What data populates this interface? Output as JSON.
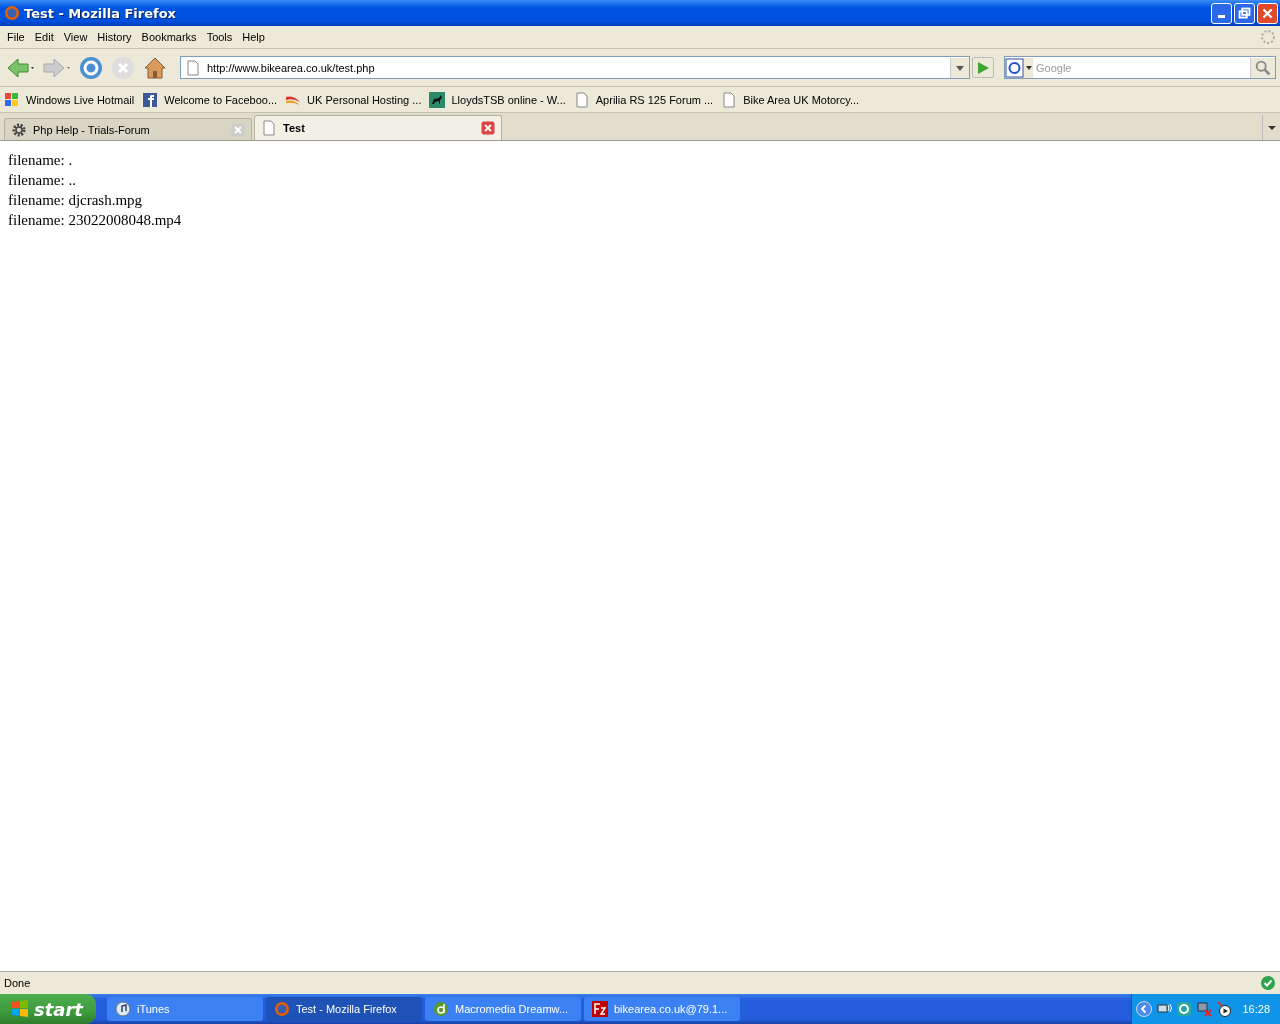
{
  "window": {
    "title": "Test - Mozilla Firefox"
  },
  "menu": [
    "File",
    "Edit",
    "View",
    "History",
    "Bookmarks",
    "Tools",
    "Help"
  ],
  "address": {
    "value": "http://www.bikearea.co.uk/test.php"
  },
  "search": {
    "placeholder": "Google"
  },
  "bookmarks": [
    {
      "label": "Windows Live Hotmail",
      "kind": "windows"
    },
    {
      "label": "Welcome to Faceboo...",
      "kind": "facebook"
    },
    {
      "label": "UK Personal Hosting ...",
      "kind": "swoosh"
    },
    {
      "label": "LloydsTSB online - W...",
      "kind": "horse"
    },
    {
      "label": "Aprilia RS 125 Forum ...",
      "kind": "page"
    },
    {
      "label": "Bike Area UK Motorcy...",
      "kind": "page"
    }
  ],
  "tabs": [
    {
      "label": "Php Help - Trials-Forum",
      "selected": false,
      "kind": "gear"
    },
    {
      "label": "Test",
      "selected": true,
      "kind": "page"
    }
  ],
  "content": [
    "filename: .",
    "filename: ..",
    "filename: djcrash.mpg",
    "filename: 23022008048.mp4"
  ],
  "status_bar": {
    "text": "Done"
  },
  "taskbar": {
    "start": "start",
    "items": [
      {
        "label": "iTunes",
        "selected": false,
        "kind": "itunes"
      },
      {
        "label": "Test - Mozilla Firefox",
        "selected": true,
        "kind": "firefox"
      },
      {
        "label": "Macromedia Dreamw...",
        "selected": false,
        "kind": "dreamweaver"
      },
      {
        "label": "bikearea.co.uk@79.1...",
        "selected": false,
        "kind": "filezilla"
      }
    ],
    "clock": "16:28"
  }
}
